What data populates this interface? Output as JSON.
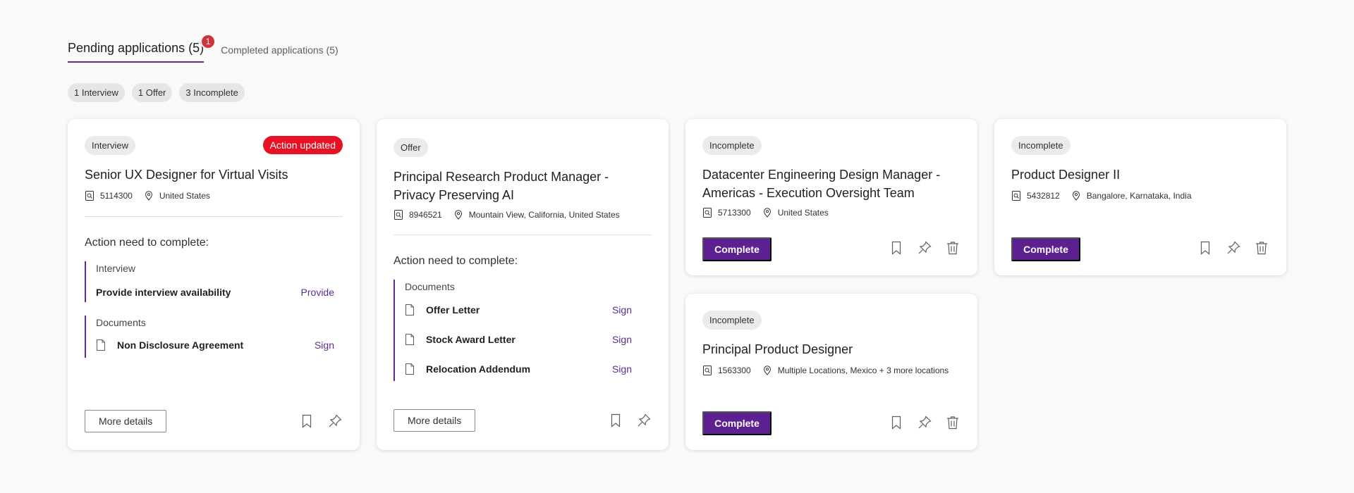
{
  "tabs": {
    "pending_label": "Pending applications (5)",
    "pending_badge": "1",
    "completed_label": "Completed applications (5)"
  },
  "filters": [
    "1 Interview",
    "1 Offer",
    "3 Incomplete"
  ],
  "colors": {
    "accent": "#5c2d91",
    "alert": "#e81123"
  },
  "cards": {
    "c1": {
      "status": "Interview",
      "alert": "Action updated",
      "title": "Senior UX Designer for Virtual Visits",
      "req_id": "5114300",
      "location": "United States",
      "section_title": "Action need to complete:",
      "group1_label": "Interview",
      "group1_item": "Provide interview availability",
      "group1_action": "Provide",
      "group2_label": "Documents",
      "group2_item": "Non Disclosure Agreement",
      "group2_action": "Sign",
      "more_details": "More details"
    },
    "c2": {
      "status": "Offer",
      "title_line1": "Principal Research Product Manager -",
      "title_line2": "Privacy Preserving AI",
      "req_id": "8946521",
      "location": "Mountain View, California, United States",
      "section_title": "Action need to complete:",
      "group_label": "Documents",
      "items": [
        {
          "label": "Offer Letter",
          "action": "Sign"
        },
        {
          "label": "Stock Award Letter",
          "action": "Sign"
        },
        {
          "label": "Relocation Addendum",
          "action": "Sign"
        }
      ],
      "more_details": "More details"
    },
    "c3": {
      "status": "Incomplete",
      "title_line1": "Datacenter Engineering Design Manager -",
      "title_line2": "Americas - Execution Oversight Team",
      "req_id": "5713300",
      "location": "United States",
      "button": "Complete"
    },
    "c4": {
      "status": "Incomplete",
      "title": "Product Designer II",
      "req_id": "5432812",
      "location": "Bangalore, Karnataka, India",
      "button": "Complete"
    },
    "c5": {
      "status": "Incomplete",
      "title": "Principal Product Designer",
      "req_id": "1563300",
      "location": "Multiple Locations, Mexico + 3 more locations",
      "button": "Complete"
    }
  }
}
